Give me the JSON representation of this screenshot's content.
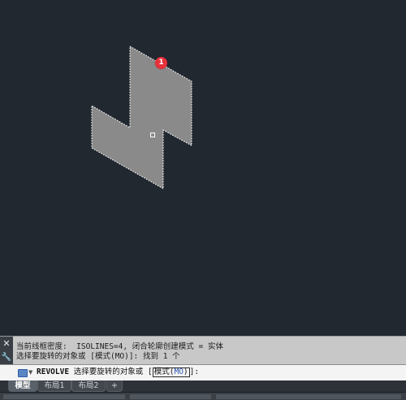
{
  "viewport": {
    "background": "#212830",
    "shape_fill": "#8a8a8a",
    "marker_badge": "1",
    "badge_color": "#e8313b"
  },
  "side_buttons": {
    "close_icon": "close-icon",
    "settings_icon": "wrench-icon"
  },
  "history": {
    "line1": "当前线框密度:  ISOLINES=4, 闭合轮廓创建模式 = 实体",
    "line2": "选择要旋转的对象或 [模式(MO)]: 找到 1 个"
  },
  "command_line": {
    "icon": "command-prompt-icon",
    "command": "REVOLVE",
    "prompt": "选择要旋转的对象或 [",
    "option_label": "模式(",
    "option_key": "MO",
    "option_close": ")",
    "suffix": "]:"
  },
  "tabs": [
    {
      "label": "模型",
      "active": true
    },
    {
      "label": "布局1",
      "active": false
    },
    {
      "label": "布局2",
      "active": false
    },
    {
      "label": "+",
      "active": false
    }
  ]
}
